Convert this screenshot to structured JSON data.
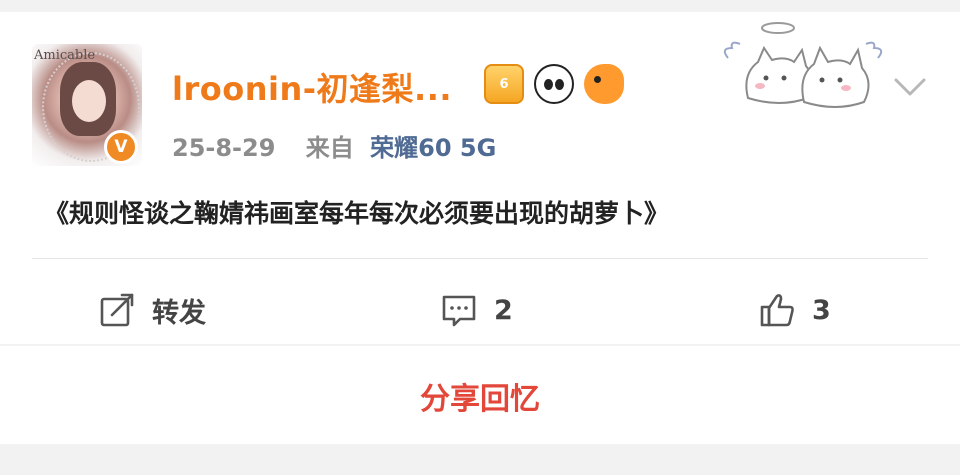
{
  "post": {
    "username": "lroonin-初逢梨...",
    "avatar_text": "Amicable",
    "verified_badge": "V",
    "badges": [
      {
        "name": "crown-badge-icon",
        "text": "6"
      },
      {
        "name": "panda-badge-icon",
        "text": ""
      },
      {
        "name": "fish-badge-icon",
        "text": ""
      }
    ],
    "date": "25-8-29",
    "from_label": "来自",
    "device": "荣耀60 5G",
    "content": "《规则怪谈之鞠婧祎画室每年每次必须要出现的胡萝卜》"
  },
  "actions": {
    "repost_label": "转发",
    "comment_count": "2",
    "like_count": "3"
  },
  "footer": {
    "share_label": "分享回忆"
  },
  "colors": {
    "username": "#ef7a1a",
    "device": "#4f6a93",
    "share": "#e2473a",
    "verified": "#f08a24"
  }
}
